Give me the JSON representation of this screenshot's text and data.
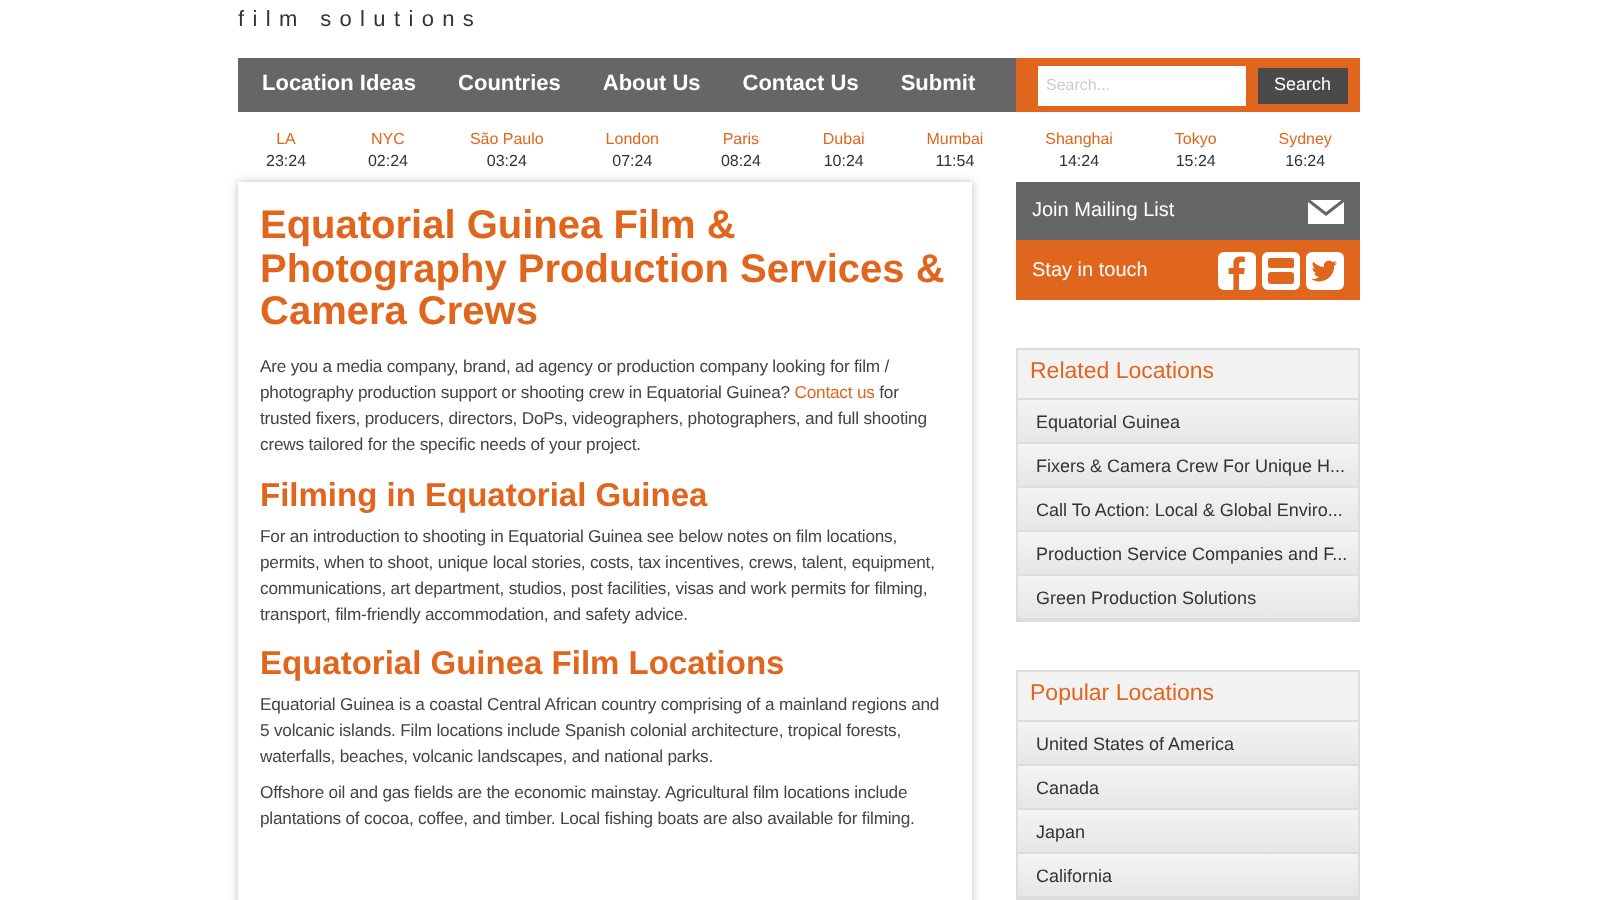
{
  "logo": {
    "tagline": "film solutions"
  },
  "nav": {
    "items": [
      "Location Ideas",
      "Countries",
      "About Us",
      "Contact Us",
      "Submit"
    ],
    "search": {
      "placeholder": "Search...",
      "button": "Search"
    }
  },
  "clocks": [
    {
      "city": "LA",
      "time": "23:24"
    },
    {
      "city": "NYC",
      "time": "02:24"
    },
    {
      "city": "São Paulo",
      "time": "03:24"
    },
    {
      "city": "London",
      "time": "07:24"
    },
    {
      "city": "Paris",
      "time": "08:24"
    },
    {
      "city": "Dubai",
      "time": "10:24"
    },
    {
      "city": "Mumbai",
      "time": "11:54"
    },
    {
      "city": "Shanghai",
      "time": "14:24"
    },
    {
      "city": "Tokyo",
      "time": "15:24"
    },
    {
      "city": "Sydney",
      "time": "16:24"
    }
  ],
  "article": {
    "title": "Equatorial Guinea Film & Photography Production Services & Camera Crews",
    "intro": {
      "before": "Are you a media company, brand, ad agency or production company looking for film / photography production support or shooting crew in Equatorial Guinea? ",
      "link": "Contact us",
      "after": " for trusted fixers, producers, directors, DoPs, videographers, photographers, and full shooting crews tailored for the specific needs of your project."
    },
    "sections": [
      {
        "heading": "Filming in Equatorial Guinea",
        "paragraphs": [
          "For an introduction to shooting in Equatorial Guinea see below notes on film locations, permits, when to shoot, unique local stories, costs, tax incentives, crews, talent, equipment, communications, art department, studios, post facilities, visas and work permits for filming, transport, film-friendly accommodation, and safety advice."
        ]
      },
      {
        "heading": "Equatorial Guinea Film Locations",
        "paragraphs": [
          "Equatorial Guinea is a coastal Central African country comprising of a mainland regions and 5 volcanic islands. Film locations include Spanish colonial architecture, tropical forests, waterfalls, beaches, volcanic landscapes, and national parks.",
          "Offshore oil and gas fields are the economic mainstay. Agricultural film locations include plantations of cocoa, coffee, and timber. Local fishing boats are also available for filming."
        ]
      }
    ]
  },
  "sidebar": {
    "mailing": "Join Mailing List",
    "social": "Stay in touch",
    "panels": [
      {
        "title": "Related Locations",
        "items": [
          "Equatorial Guinea",
          "Fixers & Camera Crew For Unique H...",
          "Call To Action: Local & Global Enviro...",
          "Production Service Companies and F...",
          "Green Production Solutions"
        ]
      },
      {
        "title": "Popular Locations",
        "items": [
          "United States of America",
          "Canada",
          "Japan",
          "California"
        ]
      }
    ]
  }
}
